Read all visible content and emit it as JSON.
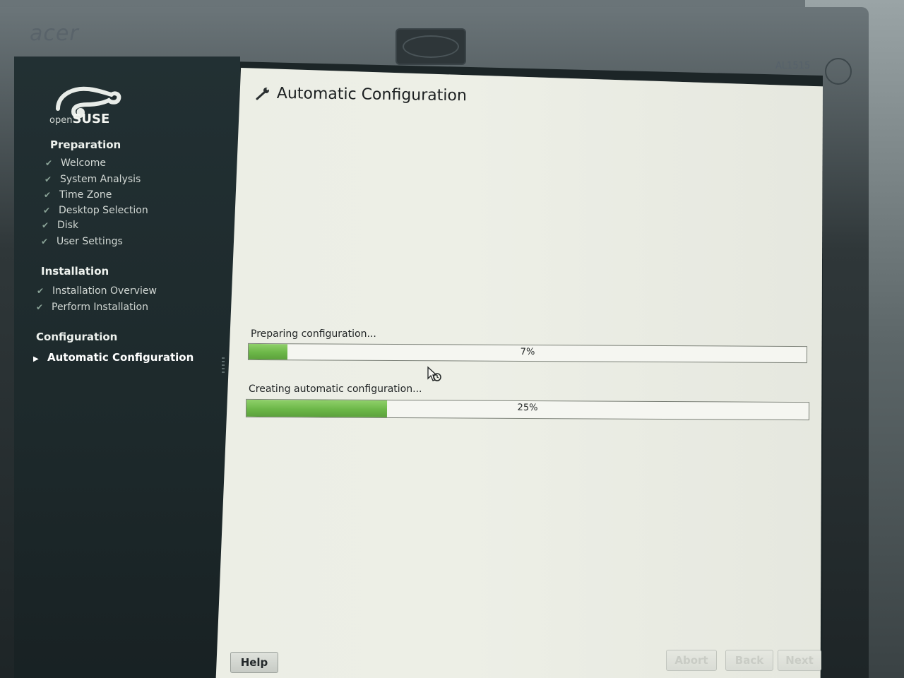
{
  "monitor": {
    "brand": "acer",
    "model": "AL1515"
  },
  "logo": {
    "open": "open",
    "suse": "SUSE",
    "icon": "opensuse-gecko-icon"
  },
  "sidebar": {
    "sections": [
      {
        "title": "Preparation",
        "steps": [
          {
            "label": "Welcome",
            "status": "done"
          },
          {
            "label": "System Analysis",
            "status": "done"
          },
          {
            "label": "Time Zone",
            "status": "done"
          },
          {
            "label": "Desktop Selection",
            "status": "done"
          },
          {
            "label": "Disk",
            "status": "done"
          },
          {
            "label": "User Settings",
            "status": "done"
          }
        ]
      },
      {
        "title": "Installation",
        "steps": [
          {
            "label": "Installation Overview",
            "status": "done"
          },
          {
            "label": "Perform Installation",
            "status": "done"
          }
        ]
      },
      {
        "title": "Configuration",
        "steps": [
          {
            "label": "Automatic Configuration",
            "status": "current"
          }
        ]
      }
    ]
  },
  "main": {
    "title": "Automatic Configuration",
    "title_icon": "wrench-icon",
    "progress": [
      {
        "label": "Preparing configuration...",
        "percent": 7,
        "text": "7%"
      },
      {
        "label": "Creating automatic configuration...",
        "percent": 25,
        "text": "25%"
      }
    ]
  },
  "buttons": {
    "help": "Help",
    "abort": "Abort",
    "back": "Back",
    "next": "Next"
  },
  "colors": {
    "progress_fill": "#6cb748",
    "content_bg": "#eceee5",
    "sidebar_bg": "#1d292b"
  }
}
